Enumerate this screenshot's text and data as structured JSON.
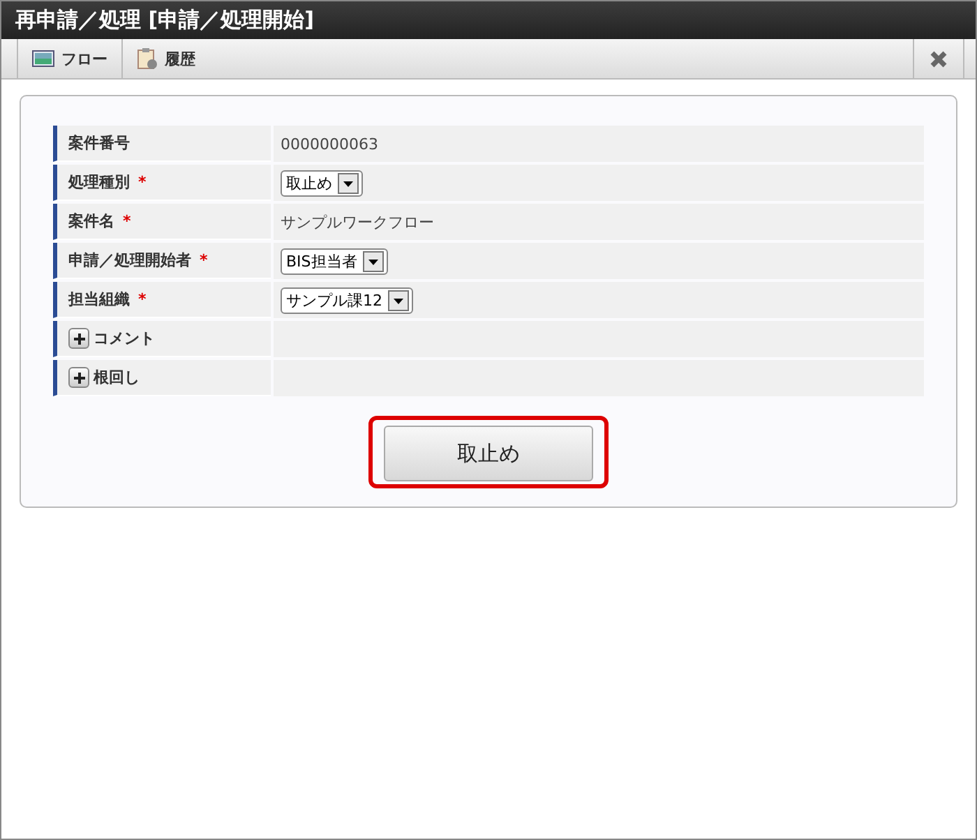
{
  "window": {
    "title": "再申請／処理 [申請／処理開始]"
  },
  "toolbar": {
    "tabs": [
      {
        "label": "フロー"
      },
      {
        "label": "履歴"
      }
    ]
  },
  "form": {
    "rows": [
      {
        "label": "案件番号",
        "kind": "text",
        "value": "0000000063"
      },
      {
        "label": "処理種別",
        "required_mark": "*",
        "kind": "select",
        "value": "取止め"
      },
      {
        "label": "案件名",
        "required_mark": "*",
        "kind": "text",
        "value": "サンプルワークフロー"
      },
      {
        "label": "申請／処理開始者",
        "required_mark": "*",
        "kind": "select",
        "value": "BIS担当者"
      },
      {
        "label": "担当組織",
        "required_mark": "*",
        "kind": "select",
        "value": "サンプル課12"
      },
      {
        "label": "コメント",
        "kind": "expand",
        "expanded": false
      },
      {
        "label": "根回し",
        "kind": "expand",
        "expanded": false
      }
    ]
  },
  "submit_button": {
    "label": "取止め",
    "highlighted": true
  }
}
